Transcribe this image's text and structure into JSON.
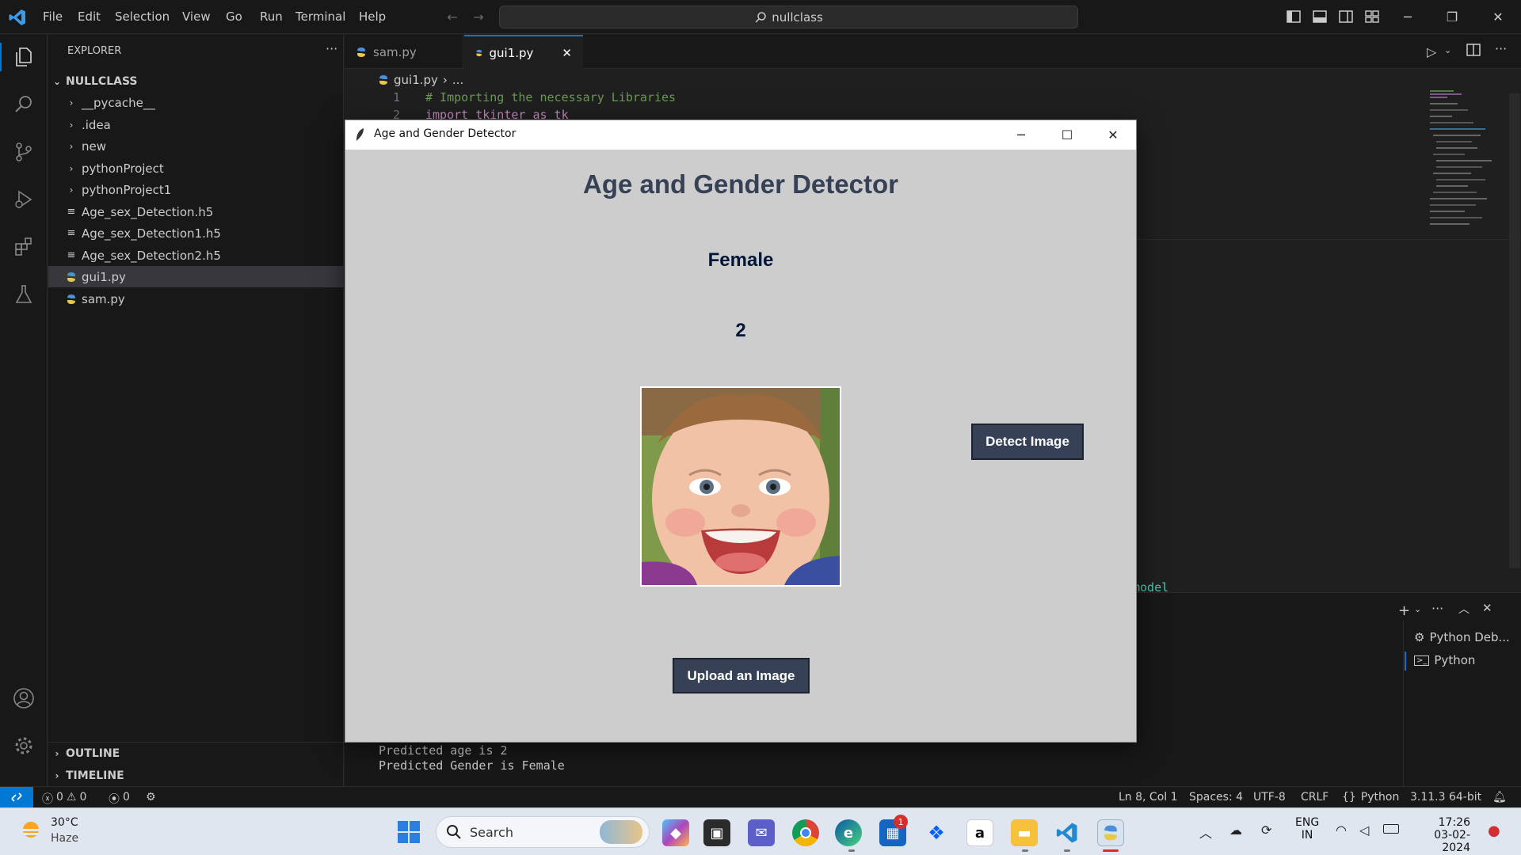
{
  "menubar": {
    "items": [
      "File",
      "Edit",
      "Selection",
      "View",
      "Go",
      "Run",
      "Terminal",
      "Help"
    ],
    "search": "nullclass"
  },
  "sidebar": {
    "title": "EXPLORER",
    "root": "NULLCLASS",
    "items": [
      {
        "label": "__pycache__",
        "type": "folder"
      },
      {
        "label": ".idea",
        "type": "folder"
      },
      {
        "label": "new",
        "type": "folder"
      },
      {
        "label": "pythonProject",
        "type": "folder"
      },
      {
        "label": "pythonProject1",
        "type": "folder"
      },
      {
        "label": "Age_sex_Detection.h5",
        "type": "file"
      },
      {
        "label": "Age_sex_Detection1.h5",
        "type": "file"
      },
      {
        "label": "Age_sex_Detection2.h5",
        "type": "file"
      },
      {
        "label": "gui1.py",
        "type": "py",
        "active": true
      },
      {
        "label": "sam.py",
        "type": "py"
      }
    ],
    "outline": "OUTLINE",
    "timeline": "TIMELINE"
  },
  "editor": {
    "tabs": [
      {
        "label": "sam.py",
        "active": false
      },
      {
        "label": "gui1.py",
        "active": true
      }
    ],
    "breadcrumb": {
      "file": "gui1.py",
      "rest": "..."
    },
    "lines": [
      {
        "num": "1",
        "text": "# Importing the necessary Libraries"
      },
      {
        "num": "2",
        "text": "import tkinter as tk"
      }
    ],
    "fragment": "model"
  },
  "terminal": {
    "lines": [
      "Predicted age is 2",
      "Predicted Gender is Female"
    ],
    "sessions": [
      "Python Deb...",
      "Python"
    ]
  },
  "statusbar": {
    "errors": "0",
    "warnings": "0",
    "ports": "0",
    "position": "Ln 8, Col 1",
    "spaces": "Spaces: 4",
    "encoding": "UTF-8",
    "eol": "CRLF",
    "language": "Python",
    "interpreter": "3.11.3 64-bit"
  },
  "dialog": {
    "window_title": "Age and Gender Detector",
    "heading": "Age and Gender Detector",
    "gender": "Female",
    "age": "2",
    "detect_button": "Detect Image",
    "upload_button": "Upload an Image"
  },
  "taskbar": {
    "weather_temp": "30°C",
    "weather_desc": "Haze",
    "search": "Search",
    "store_badge": "1",
    "lang_top": "ENG",
    "lang_bottom": "IN",
    "time": "17:26",
    "date": "03-02-2024"
  },
  "colors": {
    "accent": "#0078d4",
    "tk_button": "#364156",
    "dialog_bg": "#cdcdcd",
    "heading": "#364156"
  }
}
